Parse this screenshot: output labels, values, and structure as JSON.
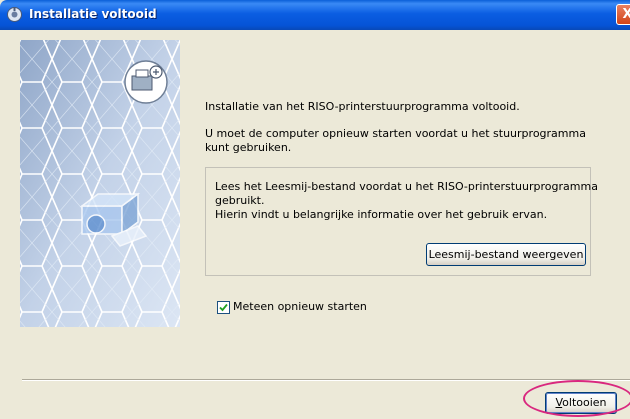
{
  "window": {
    "title": "Installatie voltooid",
    "close_symbol": "X"
  },
  "messages": {
    "done": "Installatie van het RISO-printerstuurprogramma voltooid.",
    "restart_line1": "U moet de computer opnieuw starten voordat u het stuurprogramma",
    "restart_line2": "kunt gebruiken."
  },
  "readme": {
    "line1": "Lees het Leesmij-bestand voordat u het RISO-printerstuurprogramma",
    "line2": "gebruikt.",
    "line3": "Hierin vindt u belangrijke informatie over het gebruik ervan.",
    "button_label": "Leesmij-bestand weergeven"
  },
  "restart_option": {
    "label": "Meteen opnieuw starten",
    "checked": true
  },
  "finish_button": {
    "accel": "V",
    "rest": "oltooien"
  },
  "colors": {
    "title_bar": "#0b5ee2",
    "highlight": "#d9287f",
    "panel": "#c9d7ea"
  },
  "icons": [
    "installer-icon",
    "close-icon",
    "printer-icon",
    "network-icon",
    "checkmark-icon"
  ]
}
